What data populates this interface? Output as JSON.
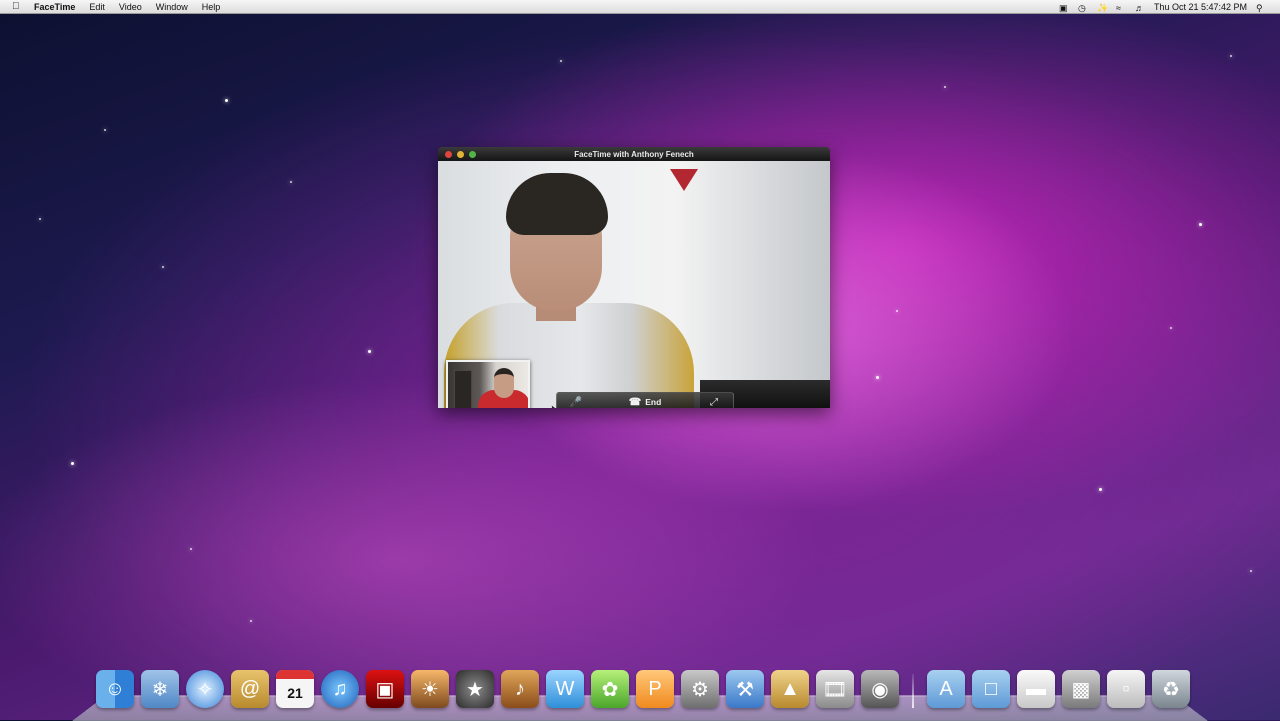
{
  "menubar": {
    "app": "FaceTime",
    "items": [
      "Edit",
      "Video",
      "Window",
      "Help"
    ],
    "clock": "Thu Oct 21  5:47:42 PM"
  },
  "facetime": {
    "title": "FaceTime with Anthony Fenech",
    "end_label": "End"
  },
  "calendar_day": "21",
  "dock_icons": [
    "finder-icon",
    "preview-icon",
    "safari-icon",
    "address-book-icon",
    "ical-icon",
    "itunes-icon",
    "photo-booth-icon",
    "iphoto-icon",
    "imovie-icon",
    "garageband-icon",
    "iweb-icon",
    "idvd-icon",
    "pages-icon",
    "system-preferences-icon",
    "xcode-icon",
    "keynote-icon",
    "iphoto-slideshow-icon",
    "facetime-icon",
    "applications-folder-icon",
    "documents-folder-icon",
    "downloads-icon",
    "screenshot-icon",
    "stack-icon",
    "trash-icon"
  ]
}
